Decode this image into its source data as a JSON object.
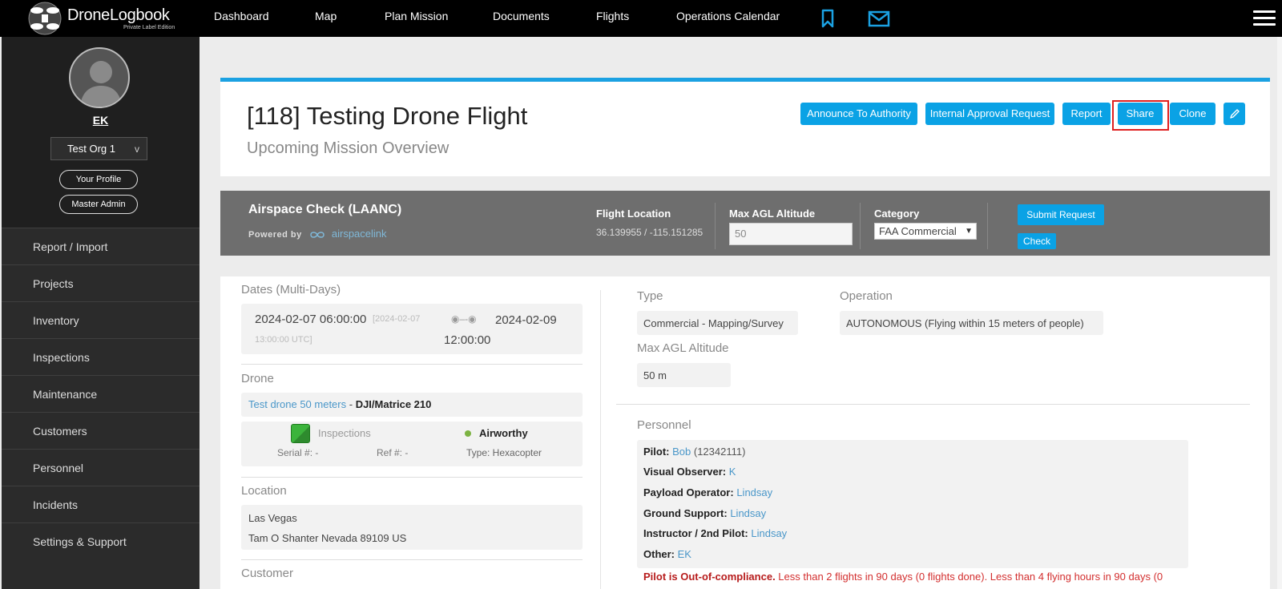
{
  "topnav": {
    "brand": "DroneLogbook",
    "edition": "Private Label Edition",
    "items": [
      "Dashboard",
      "Map",
      "Plan Mission",
      "Documents",
      "Flights",
      "Operations Calendar"
    ],
    "accent": "#1ba1e2"
  },
  "sidebar": {
    "username": "EK",
    "org": "Test Org 1",
    "org_caret": "v",
    "profile_btn": "Your Profile",
    "admin_btn": "Master Admin",
    "items": [
      "Report / Import",
      "Projects",
      "Inventory",
      "Inspections",
      "Maintenance",
      "Customers",
      "Personnel",
      "Incidents",
      "Settings & Support"
    ]
  },
  "header": {
    "title": "[118] Testing Drone Flight",
    "subtitle": "Upcoming Mission Overview",
    "buttons": [
      "Announce To Authority",
      "Internal Approval Request",
      "Report",
      "Share",
      "Clone"
    ]
  },
  "airspace": {
    "title": "Airspace Check (LAANC)",
    "powered_by": "Powered by",
    "provider": "airspacelink",
    "flight_location_label": "Flight Location",
    "flight_location_value": "36.139955 / -115.151285",
    "max_agl_label": "Max AGL Altitude",
    "max_agl_value": "50",
    "category_label": "Category",
    "category_value": "FAA Commercial",
    "submit_label": "Submit Request",
    "check_label": "Check"
  },
  "details": {
    "dates_label": "Dates (Multi-Days)",
    "start_date": "2024-02-07 06:00:00",
    "start_utc_a": "[2024-02-07",
    "start_utc_b": "13:00:00 UTC]",
    "range_glyph": "◉–-◉",
    "end_date": "2024-02-09",
    "end_time": "12:00:00",
    "drone_label": "Drone",
    "drone_link": "Test drone 50 meters",
    "drone_sep": " - ",
    "drone_model": "DJI/Matrice 210",
    "inspections_label": "Inspections",
    "airworthy": "Airworthy",
    "serial": "Serial #: -",
    "ref": "Ref #: -",
    "type_drone": "Type: Hexacopter",
    "location_label": "Location",
    "location_city": "Las Vegas",
    "location_address": "Tam O Shanter Nevada 89109 US",
    "customer_label": "Customer",
    "type_label": "Type",
    "type_value": "Commercial - Mapping/Survey",
    "operation_label": "Operation",
    "operation_value": "AUTONOMOUS (Flying within 15 meters of people)",
    "max_agl_label": "Max AGL Altitude",
    "max_agl_value": "50 m",
    "personnel_label": "Personnel",
    "personnel": [
      {
        "role": "Pilot:",
        "name": "Bob",
        "extra": " (12342111)"
      },
      {
        "role": "Visual Observer:",
        "name": "K",
        "extra": ""
      },
      {
        "role": "Payload Operator:",
        "name": "Lindsay",
        "extra": ""
      },
      {
        "role": "Ground Support:",
        "name": "Lindsay",
        "extra": ""
      },
      {
        "role": "Instructor / 2nd Pilot:",
        "name": "Lindsay",
        "extra": ""
      },
      {
        "role": "Other:",
        "name": "EK",
        "extra": ""
      }
    ],
    "compliance_bold": "Pilot is Out-of-compliance.",
    "compliance_text": " Less than 2 flights in 90 days (0 flights done). Less than 4 flying hours in 90 days (0"
  }
}
